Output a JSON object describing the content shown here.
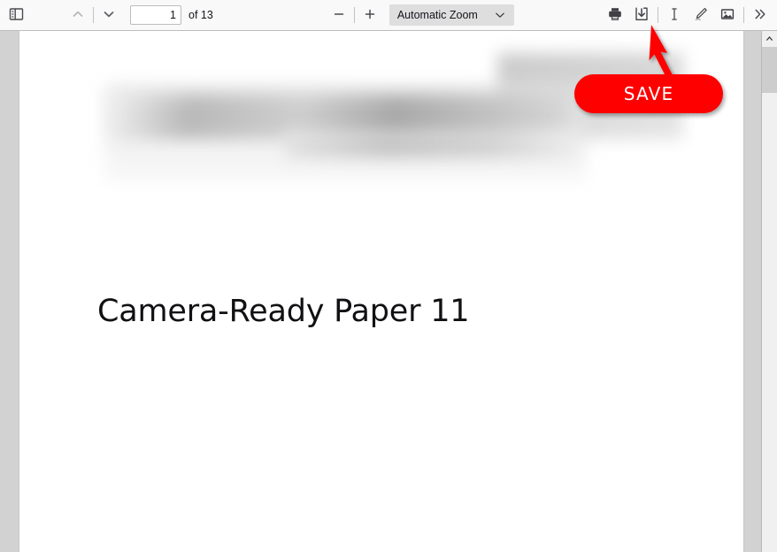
{
  "toolbar": {
    "sidebar_toggle": {
      "icon": "sidebar-toggle-icon",
      "title": "Toggle Sidebar"
    },
    "previous_page": {
      "icon": "chevron-up-icon",
      "title": "Previous Page"
    },
    "next_page": {
      "icon": "chevron-down-icon",
      "title": "Next Page"
    },
    "page_input_value": "1",
    "page_total_label": "of 13",
    "zoom_out": {
      "icon": "minus-icon",
      "title": "Zoom Out"
    },
    "zoom_in": {
      "icon": "plus-icon",
      "title": "Zoom In"
    },
    "zoom_select": {
      "selected": "Automatic Zoom",
      "chevron": "chevron-down-icon"
    },
    "tools": [
      {
        "name": "print-button",
        "icon": "printer-icon",
        "title": "Print"
      },
      {
        "name": "save-button",
        "icon": "download-save-icon",
        "title": "Save"
      },
      {
        "name": "text-select-button",
        "icon": "text-cursor-icon",
        "title": "Text Selection"
      },
      {
        "name": "draw-button",
        "icon": "pen-draw-icon",
        "title": "Draw"
      },
      {
        "name": "image-button",
        "icon": "image-icon",
        "title": "Add Image"
      },
      {
        "name": "more-tools-button",
        "icon": "double-chevron-right-icon",
        "title": "Tools"
      }
    ]
  },
  "document": {
    "title": "Camera-Ready Paper 11",
    "redacted_note": "blurred text"
  },
  "annotation": {
    "label": "SAVE",
    "color": "#ff0000",
    "text_color": "#ffffff",
    "arrow_target": "save-button"
  },
  "scrollbar": {
    "up_arrow_icon": "scroll-up-arrow-icon"
  },
  "colors": {
    "toolbar_bg": "#f9f9fa",
    "viewer_bg": "#d2d2d3",
    "page_bg": "#ffffff",
    "accent_red": "#ff0000",
    "select_bg": "#dededf"
  }
}
